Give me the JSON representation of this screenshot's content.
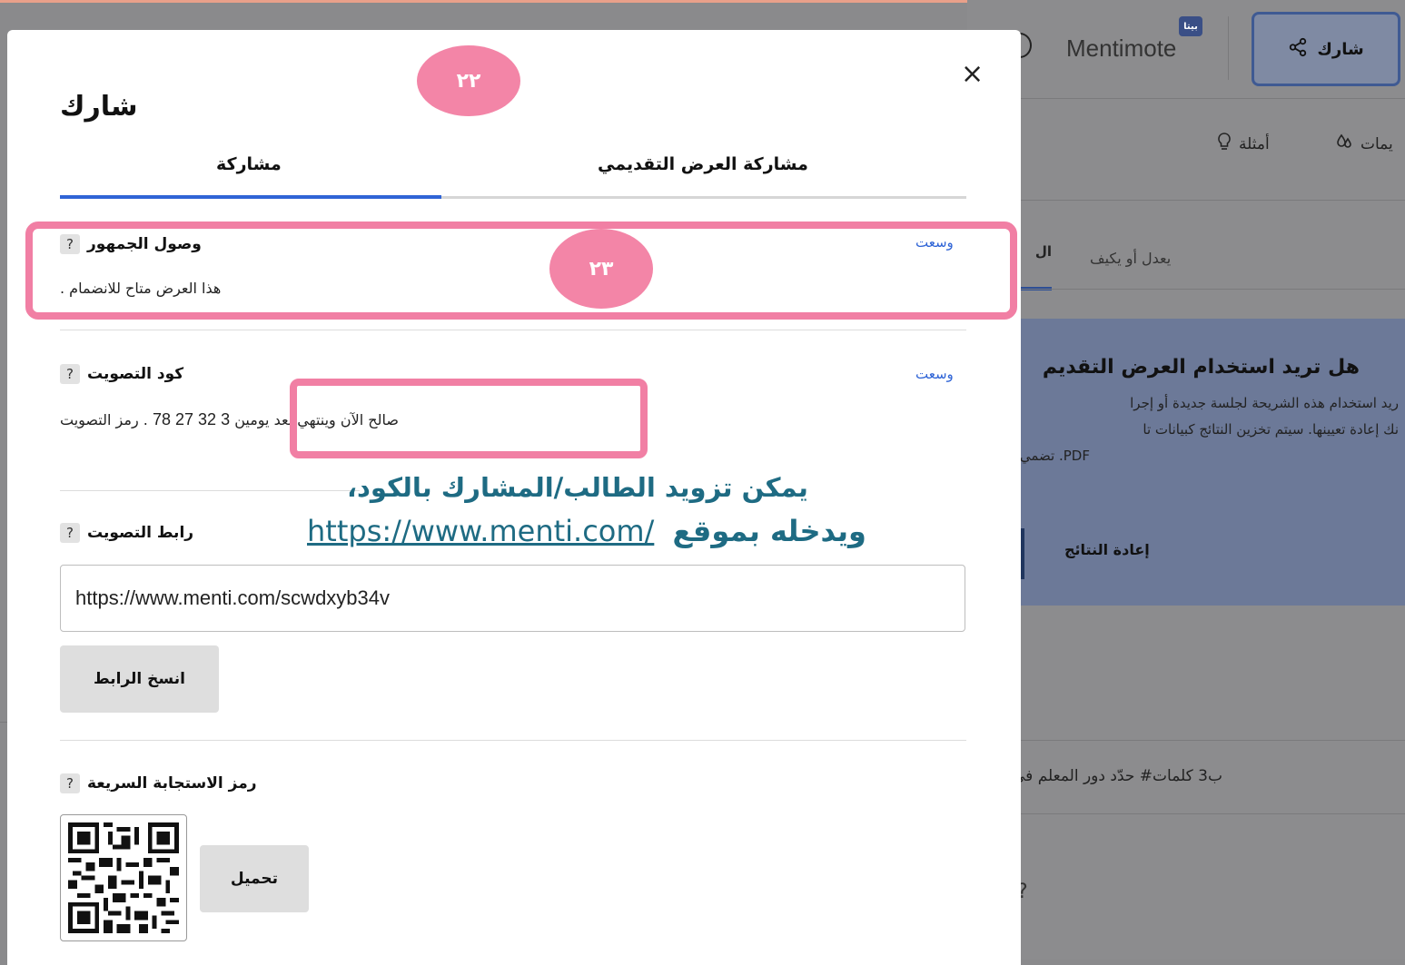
{
  "background": {
    "share_button": "شارك",
    "beta_badge": "بيتا",
    "mentimote": "Mentimote",
    "examples": "أمثلة",
    "templates": "يمات",
    "tab_adapt": "يعدل أو يكيف",
    "tab_active": "ال",
    "card_title": "هل تريد استخدام العرض التقديم",
    "card_line1": "ريد استخدام هذه الشريحة لجلسة جديدة أو إجرا",
    "card_line2": "نك إعادة تعيينها. سيتم تخزين النتائج كبيانات تا",
    "card_line3": "PDF. تضمي",
    "reset_results": "إعادة النتائج",
    "list_item": "ب3 كلمات# حدّد دور المعلم في",
    "question_mark": "?"
  },
  "modal": {
    "title": "شارك",
    "close": "×",
    "tabs": [
      "مشاركة",
      "مشاركة العرض التقديمي"
    ],
    "audience_access": {
      "label": "وصول الجمهور",
      "help": "?",
      "edit": "وسعت",
      "text": ". هذا العرض متاح للانضمام"
    },
    "voting_code": {
      "label": "كود التصويت",
      "help": "?",
      "edit": "وسعت",
      "text_prefix": "صالح الآن وينتهي بعد يومين",
      "code": "3 32 27 78",
      "text_suffix": ". رمز التصويت"
    },
    "voting_link": {
      "label": "رابط التصويت",
      "help": "?",
      "url": "https://www.menti.com/scwdxyb34v",
      "copy_button": "انسخ الرابط"
    },
    "qr_code": {
      "label": "رمز الاستجابة السريعة",
      "help": "?",
      "download_button": "تحميل"
    }
  },
  "annotations": {
    "bubble_22": "٢٢",
    "bubble_23": "٢٣",
    "note_line1": "يمكن تزويد الطالب/المشارك بالكود،",
    "note_line2_word": "ويدخله بموقع",
    "note_line2_url": "https://www.menti.com/",
    "accent_color": "#f17fa4",
    "note_color": "#1e6b83"
  }
}
